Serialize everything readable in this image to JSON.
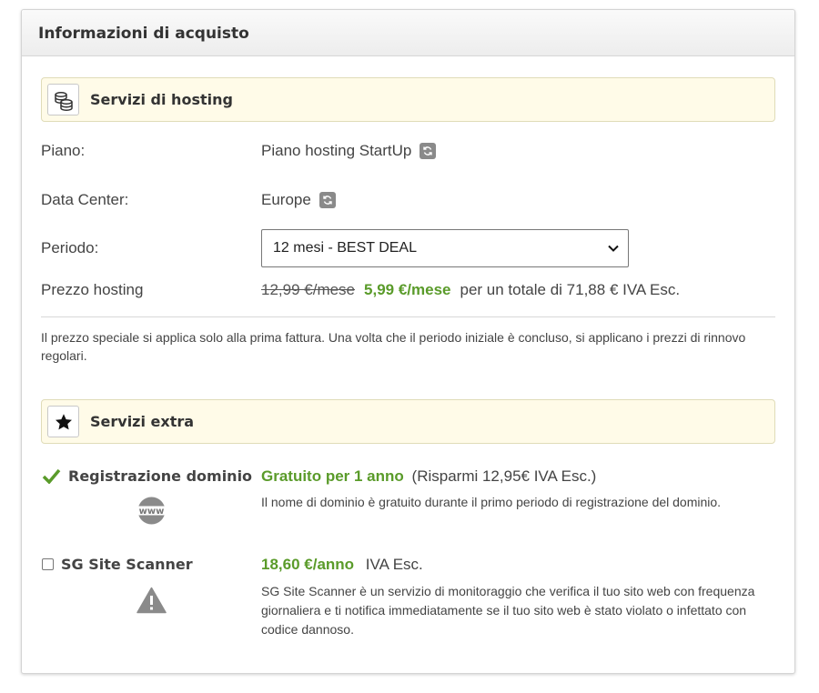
{
  "panel": {
    "title": "Informazioni di acquisto"
  },
  "hosting": {
    "title": "Servizi di hosting",
    "icon": "coins-icon",
    "rows": {
      "plan_label": "Piano:",
      "plan_value": "Piano hosting StartUp",
      "dc_label": "Data Center:",
      "dc_value": "Europe",
      "period_label": "Periodo:",
      "period_selected": "12 mesi - BEST DEAL",
      "price_label": "Prezzo hosting",
      "price_old": "12,99 €/mese",
      "price_new": "5,99 €/mese",
      "price_total": "per un totale di 71,88 € IVA Esc."
    },
    "note": "Il prezzo speciale si applica solo alla prima fattura. Una volta che il periodo iniziale è concluso, si applicano i prezzi di rinnovo regolari."
  },
  "extras": {
    "title": "Servizi extra",
    "icon": "star-icon",
    "domain": {
      "name": "Registrazione dominio",
      "checked": true,
      "icon_text": "www",
      "price": "Gratuito per 1 anno",
      "price_suffix": "(Risparmi 12,95€ IVA Esc.)",
      "desc": "Il nome di dominio è gratuito durante il primo periodo di registrazione del dominio."
    },
    "scanner": {
      "name": "SG Site Scanner",
      "checked": false,
      "price": "18,60 €/anno",
      "price_suffix": "IVA Esc.",
      "desc": "SG Site Scanner è un servizio di monitoraggio che verifica il tuo sito web con frequenza giornaliera e ti notifica immediatamente se il tuo sito web è stato violato o infettato con codice dannoso."
    }
  },
  "colors": {
    "accent_green": "#5a9b2a",
    "section_bg": "#fffbe8",
    "icon_gray": "#8a8a8a"
  }
}
